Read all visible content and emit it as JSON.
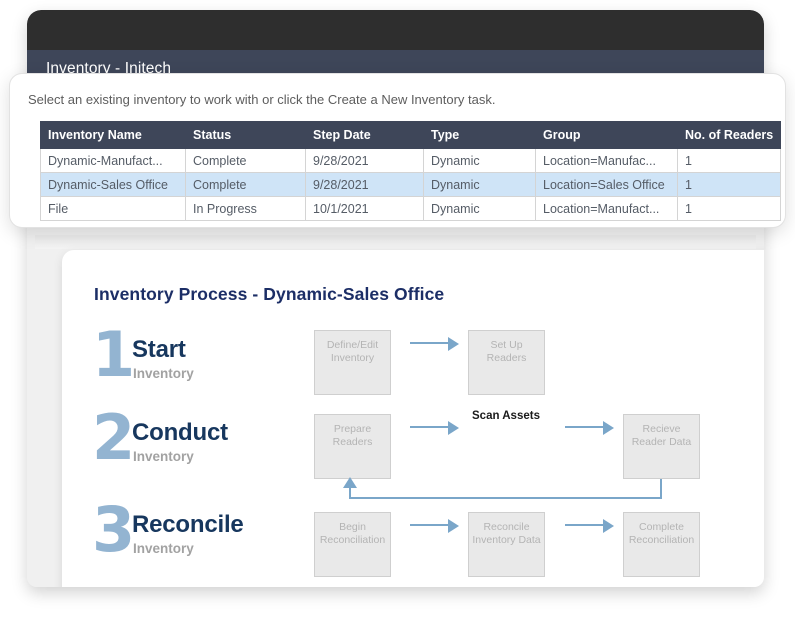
{
  "window": {
    "title": "Inventory - Initech"
  },
  "inventory_card": {
    "instruction": "Select an existing inventory to work with or click the Create a New Inventory task.",
    "table": {
      "columns": [
        "Inventory Name",
        "Status",
        "Step Date",
        "Type",
        "Group",
        "No. of Readers"
      ],
      "rows": [
        {
          "selected": false,
          "cells": [
            "Dynamic-Manufact...",
            "Complete",
            "9/28/2021",
            "Dynamic",
            "Location=Manufac...",
            "1"
          ]
        },
        {
          "selected": true,
          "cells": [
            "Dynamic-Sales Office",
            "Complete",
            "9/28/2021",
            "Dynamic",
            "Location=Sales Office",
            "1"
          ]
        },
        {
          "selected": false,
          "cells": [
            "File",
            "In Progress",
            "10/1/2021",
            "Dynamic",
            "Location=Manufact...",
            "1"
          ]
        }
      ]
    }
  },
  "process": {
    "title": "Inventory Process - Dynamic-Sales Office",
    "stages": [
      {
        "number": "1",
        "title": "Start",
        "subtitle": "Inventory"
      },
      {
        "number": "2",
        "title": "Conduct",
        "subtitle": "Inventory"
      },
      {
        "number": "3",
        "title": "Reconcile",
        "subtitle": "Inventory"
      }
    ],
    "boxes": [
      {
        "label": "Define/Edit\nInventory"
      },
      {
        "label": "Set Up\nReaders"
      },
      {
        "label": "Prepare\nReaders"
      },
      {
        "label": "Recieve\nReader Data"
      },
      {
        "label": "Begin\nReconciliation"
      },
      {
        "label": "Reconcile\nInventory Data"
      },
      {
        "label": "Complete\nReconciliation"
      }
    ],
    "scan_assets_label": "Scan Assets"
  },
  "colors": {
    "titlebar_top": "#2e2e2e",
    "titlebar_main": "#3e4659",
    "table_header": "#3e4659",
    "row_selected": "#cfe4f7",
    "stage_number": "#93b4d1",
    "stage_title": "#17375e",
    "process_title": "#1c2e66",
    "arrow": "#7aa6c9",
    "box_fill": "#e9e9e9",
    "box_text": "#b4b4b4"
  }
}
